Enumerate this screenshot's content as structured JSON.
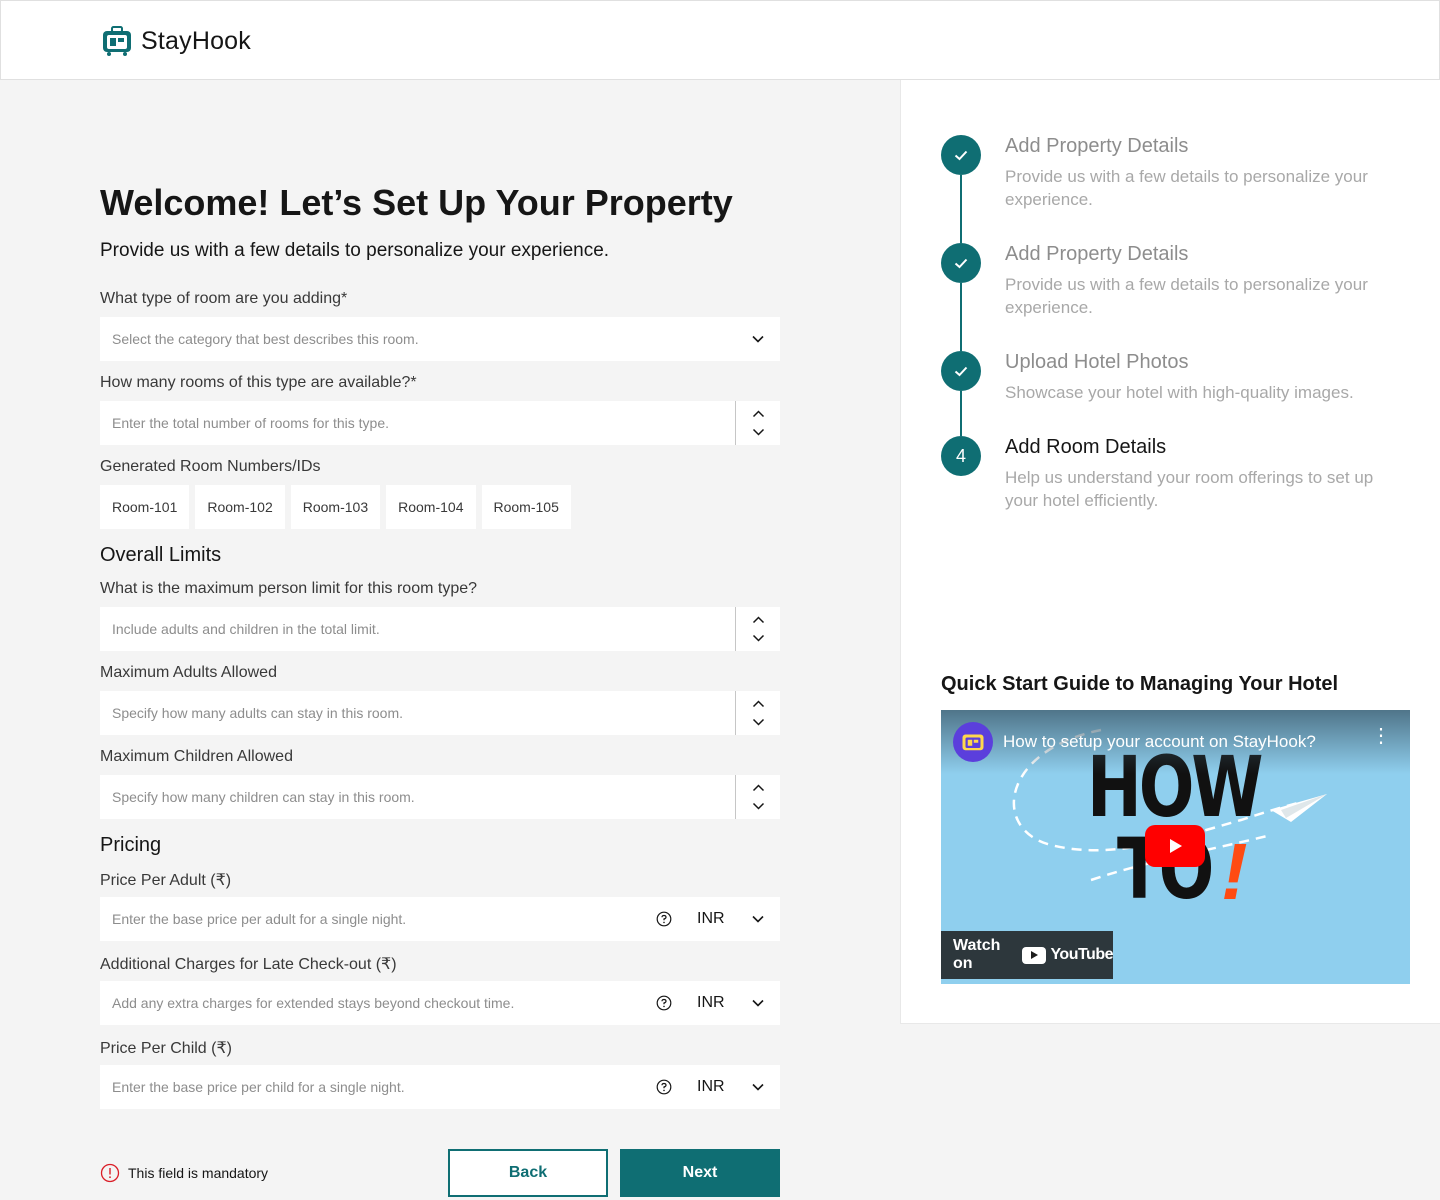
{
  "app": {
    "name": "StayHook"
  },
  "page": {
    "title": "Welcome! Let’s Set Up Your Property",
    "subtitle": "Provide us with a few details to personalize your experience."
  },
  "form": {
    "room_type": {
      "label": "What type of room are you adding*",
      "placeholder": "Select the category that best describes this room."
    },
    "room_count": {
      "label": "How many rooms of this type are available?*",
      "placeholder": "Enter the total number of rooms for this type."
    },
    "room_ids": {
      "label": "Generated Room Numbers/IDs",
      "items": [
        "Room-101",
        "Room-102",
        "Room-103",
        "Room-104",
        "Room-105"
      ]
    },
    "limits": {
      "heading": "Overall Limits",
      "max_person": {
        "label": "What is the maximum person limit for this room type?",
        "placeholder": "Include adults and children in the total limit."
      },
      "max_adults": {
        "label": "Maximum Adults Allowed",
        "placeholder": "Specify how many adults can stay in this room."
      },
      "max_children": {
        "label": "Maximum Children Allowed",
        "placeholder": "Specify how many children can stay in this room."
      }
    },
    "pricing": {
      "heading": "Pricing",
      "per_adult": {
        "label": "Price Per Adult (₹)",
        "placeholder": "Enter the base price per adult for a single night.",
        "currency": "INR"
      },
      "late_checkout": {
        "label": "Additional Charges for Late Check-out (₹)",
        "placeholder": "Add any extra charges for extended stays beyond checkout time.",
        "currency": "INR"
      },
      "per_child": {
        "label": "Price Per Child (₹)",
        "placeholder": "Enter the base price per child for a single night.",
        "currency": "INR"
      }
    },
    "mandatory_note": "This field is mandatory",
    "back_label": "Back",
    "next_label": "Next"
  },
  "steps": [
    {
      "title": "Add Property Details",
      "desc": "Provide us with a few details to personalize your experience.",
      "status": "done"
    },
    {
      "title": "Add Property Details",
      "desc": "Provide us with a few details to personalize your experience.",
      "status": "done"
    },
    {
      "title": "Upload Hotel Photos",
      "desc": "Showcase your hotel with high-quality images.",
      "status": "done"
    },
    {
      "number": "4",
      "title": "Add Room Details",
      "desc": "Help us understand your room offerings to set up your hotel efficiently.",
      "status": "active"
    }
  ],
  "guide": {
    "title": "Quick Start Guide to Managing Your Hotel",
    "video_title": "How to setup your account on StayHook?",
    "thumb_line1": "HOW",
    "thumb_line2": "TO",
    "thumb_accent": "!",
    "watch_on": "Watch on",
    "youtube": "YouTube"
  },
  "colors": {
    "brand": "#0f6e73",
    "background": "#f4f4f4",
    "accent_red": "#ff0000"
  }
}
